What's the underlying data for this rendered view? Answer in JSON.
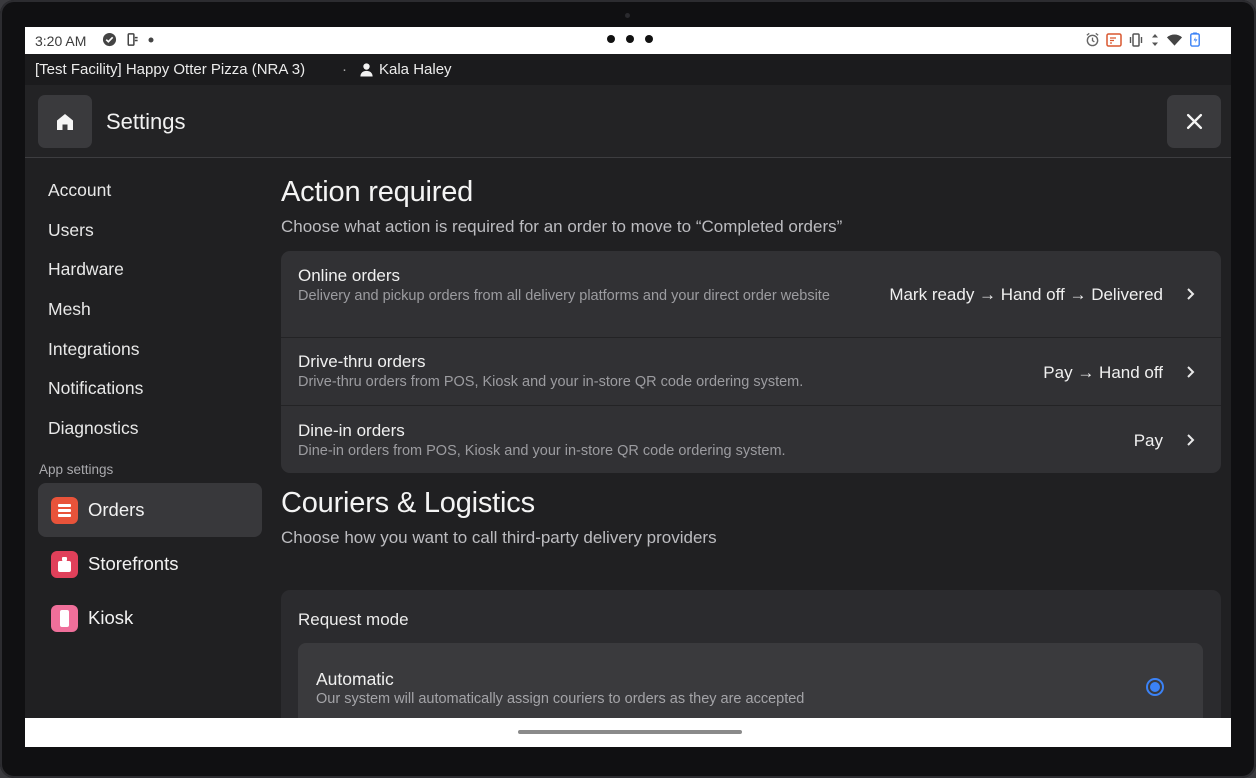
{
  "status_bar": {
    "time": "3:20 AM",
    "left_icons": [
      "check-circle-icon",
      "usb-icon",
      "dot-icon"
    ],
    "right_icons": [
      "alarm-icon",
      "cast-icon",
      "vibrate-icon",
      "data-arrows-icon",
      "wifi-icon",
      "battery-charging-icon"
    ]
  },
  "info_bar": {
    "facility": "[Test Facility] Happy Otter Pizza (NRA 3)",
    "separator": "·",
    "user": "Kala Haley"
  },
  "header": {
    "title": "Settings"
  },
  "sidebar": {
    "items": [
      {
        "label": "Account"
      },
      {
        "label": "Users"
      },
      {
        "label": "Hardware"
      },
      {
        "label": "Mesh"
      },
      {
        "label": "Integrations"
      },
      {
        "label": "Notifications"
      },
      {
        "label": "Diagnostics"
      }
    ],
    "app_settings_label": "App settings",
    "apps": [
      {
        "label": "Orders",
        "color": "#e8533a",
        "active": true
      },
      {
        "label": "Storefronts",
        "color": "#e0405a",
        "active": false
      },
      {
        "label": "Kiosk",
        "color": "#ef6f9a",
        "active": false
      }
    ]
  },
  "action_required": {
    "title": "Action required",
    "subtitle": "Choose what action is required for an order to move to “Completed orders”",
    "rows": [
      {
        "title": "Online orders",
        "description": "Delivery and pickup orders from all delivery platforms and your direct order website",
        "value": "Mark ready → Hand off → Delivered"
      },
      {
        "title": "Drive-thru orders",
        "description": "Drive-thru orders from POS, Kiosk and your in-store QR code ordering system.",
        "value": "Pay → Hand off"
      },
      {
        "title": "Dine-in orders",
        "description": "Dine-in orders from POS, Kiosk and your in-store QR code ordering system.",
        "value": "Pay"
      }
    ]
  },
  "couriers": {
    "title": "Couriers & Logistics",
    "subtitle": "Choose how you want to call third-party delivery providers",
    "request_mode_label": "Request mode",
    "options": [
      {
        "title": "Automatic",
        "description": "Our system will automatically assign couriers to orders as they are accepted",
        "selected": true
      }
    ]
  },
  "colors": {
    "accent": "#3b82f6",
    "background": "#202022",
    "card": "#313134"
  }
}
